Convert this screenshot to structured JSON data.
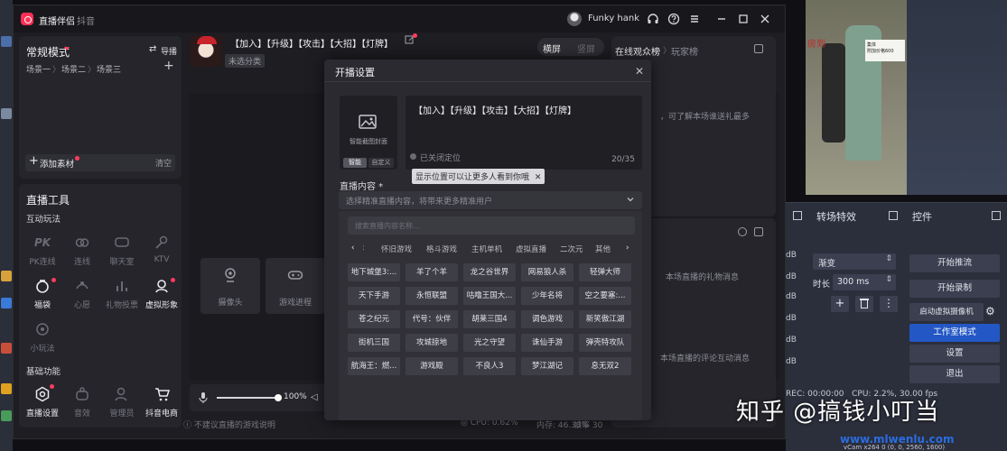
{
  "app": {
    "name": "直播伴侣",
    "sub": "抖音",
    "username": "Funky hank"
  },
  "left_panel": {
    "mode_label": "常规模式",
    "import_label": "导播",
    "scenes": [
      "场景一",
      "场景二",
      "场景三"
    ],
    "add_material": "添加素材",
    "clear": "清空",
    "tools_title": "直播工具",
    "interactive_title": "互动玩法",
    "tools": [
      "PK连线",
      "连线",
      "聊天室",
      "KTV",
      "福袋",
      "心愿",
      "礼物投票",
      "虚拟形象",
      "小玩法"
    ],
    "basic_title": "基础功能",
    "basic": [
      "直播设置",
      "音效",
      "管理员",
      "抖音电商"
    ]
  },
  "center": {
    "stream_title": "【加入】【升级】【攻击】【大招】【灯牌】",
    "category_tag": "未选分类",
    "orient_landscape": "横屏",
    "orient_portrait": "竖屏",
    "sources": [
      "摄像头",
      "游戏进程"
    ],
    "volume": "100%",
    "status_left": "不建议直播的游戏说明",
    "status_cpu": "CPU: 0.62%",
    "status_mem": "内存: 46.33%",
    "status_frame": "帧率 30"
  },
  "right_in_app": {
    "tab_online": "在线观众榜",
    "tab_fans": "玩家榜",
    "hint1": "，可了解本场谁送礼最多",
    "hint2": "本场直播的礼物消息",
    "hint3": "本场直播的评论互动消息"
  },
  "modal": {
    "title": "开播设置",
    "cover_label": "智能截图封面",
    "cover_smart": "智能",
    "cover_custom": "自定义",
    "title_value": "【加入】【升级】【攻击】【大招】【灯牌】",
    "count": "20/35",
    "location_off": "已关闭定位",
    "location_tip": "显示位置可以让更多人看到你哦",
    "content_label": "直播内容",
    "content_placeholder": "选择精准直播内容，将带来更多精准用户",
    "search_placeholder": "搜索直播内容名称...",
    "categories": [
      "怀旧游戏",
      "格斗游戏",
      "主机单机",
      "虚拟直播",
      "二次元",
      "其他"
    ],
    "games": [
      "地下城堡3:...",
      "羊了个羊",
      "龙之谷世界",
      "网易狼人杀",
      "轻弹大师",
      "天下手游",
      "永恒联盟",
      "咕噜王国大...",
      "少年名将",
      "空之要塞:...",
      "苍之纪元",
      "代号：伙伴",
      "胡莱三国4",
      "调色游戏",
      "新笑傲江湖",
      "街机三国",
      "攻城掠地",
      "光之守望",
      "诛仙手游",
      "弹壳特攻队",
      "航海王：燃...",
      "游戏殿",
      "不良人3",
      "梦江湖记",
      "息无双2"
    ]
  },
  "obs": {
    "transition_title": "转场特效",
    "controls_title": "控件",
    "transition_value": "渐变",
    "duration_label": "时长",
    "duration_value": "300 ms",
    "db_label": "dB",
    "buttons": [
      "开始推流",
      "开始录制",
      "启动虚拟摄像机",
      "工作室模式",
      "设置",
      "退出"
    ],
    "stats": "REC: 00:00:00   CPU: 2.2%, 30.00 fps",
    "version": "vCam x264 0 (0, 0, 2560, 1600)"
  },
  "camera_overlay": {
    "left_text": "房到",
    "sign_text": "集体\n附加价格600"
  },
  "watermark": {
    "main": "知乎 @搞钱小叮当",
    "url": "www.mlwenlu.com"
  }
}
